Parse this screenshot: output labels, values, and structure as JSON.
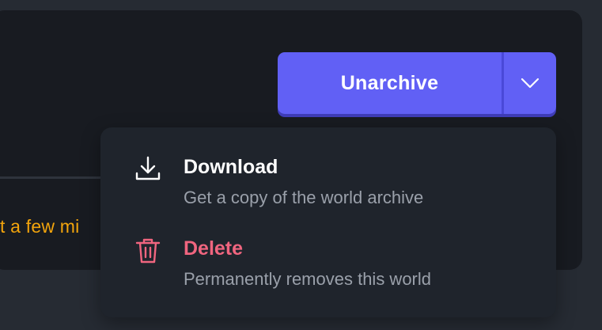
{
  "background": {
    "notice_text": "t a few mi"
  },
  "split_button": {
    "primary_label": "Unarchive",
    "toggle_icon": "chevron-down-icon"
  },
  "menu": {
    "items": [
      {
        "icon": "download-icon",
        "title": "Download",
        "description": "Get a copy of the world archive"
      },
      {
        "icon": "trash-icon",
        "title": "Delete",
        "description": "Permanently removes this world"
      }
    ]
  },
  "colors": {
    "page_bg": "#262b33",
    "card_bg": "#181b21",
    "menu_bg": "#1f242c",
    "accent": "#6160f5",
    "warning_text": "#f2a40c",
    "danger": "#f0657f",
    "muted_text": "#9aa0aa"
  }
}
